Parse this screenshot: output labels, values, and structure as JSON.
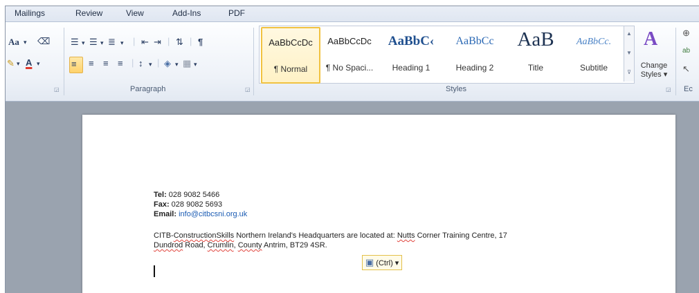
{
  "tabs": [
    "Mailings",
    "Review",
    "View",
    "Add-Ins",
    "PDF"
  ],
  "font_group": {
    "font_size_icon": "Aa",
    "font_color_label": "A"
  },
  "paragraph_group": {
    "label": "Paragraph",
    "pilcrow": "¶"
  },
  "styles_group": {
    "label": "Styles",
    "items": [
      {
        "preview": "AaBbCcDc",
        "name": "¶ Normal"
      },
      {
        "preview": "AaBbCcDc",
        "name": "¶ No Spaci..."
      },
      {
        "preview": "AaBbC‹",
        "name": "Heading 1"
      },
      {
        "preview": "AaBbCc",
        "name": "Heading 2"
      },
      {
        "preview": "AaB",
        "name": "Title"
      },
      {
        "preview": "AaBbCc.",
        "name": "Subtitle"
      }
    ],
    "change_styles": "Change\nStyles ▾"
  },
  "editing_group": {
    "label": "Ec"
  },
  "document": {
    "tel_label": "Tel:",
    "tel_value": " 028 9082 5466",
    "fax_label": "Fax:",
    "fax_value": " 028 9082 5693",
    "email_label": "Email:",
    "email_value": "info@citbcsni.org.uk",
    "para_line1_a": "CITB-",
    "para_line1_b": "ConstructionSkills",
    "para_line1_c": " Northern Ireland's Headquarters are located at: ",
    "para_line1_d": "Nutts",
    "para_line1_e": " Corner Training Centre, 17",
    "para_line2_a": "Dundrod",
    "para_line2_b": " Road, ",
    "para_line2_c": "Crumlin",
    "para_line2_d": ", ",
    "para_line2_e": "County",
    "para_line2_f": " Antrim, BT29 4SR."
  },
  "paste_options": {
    "label": "(Ctrl) ▾",
    "icon": "clipboard-icon"
  }
}
